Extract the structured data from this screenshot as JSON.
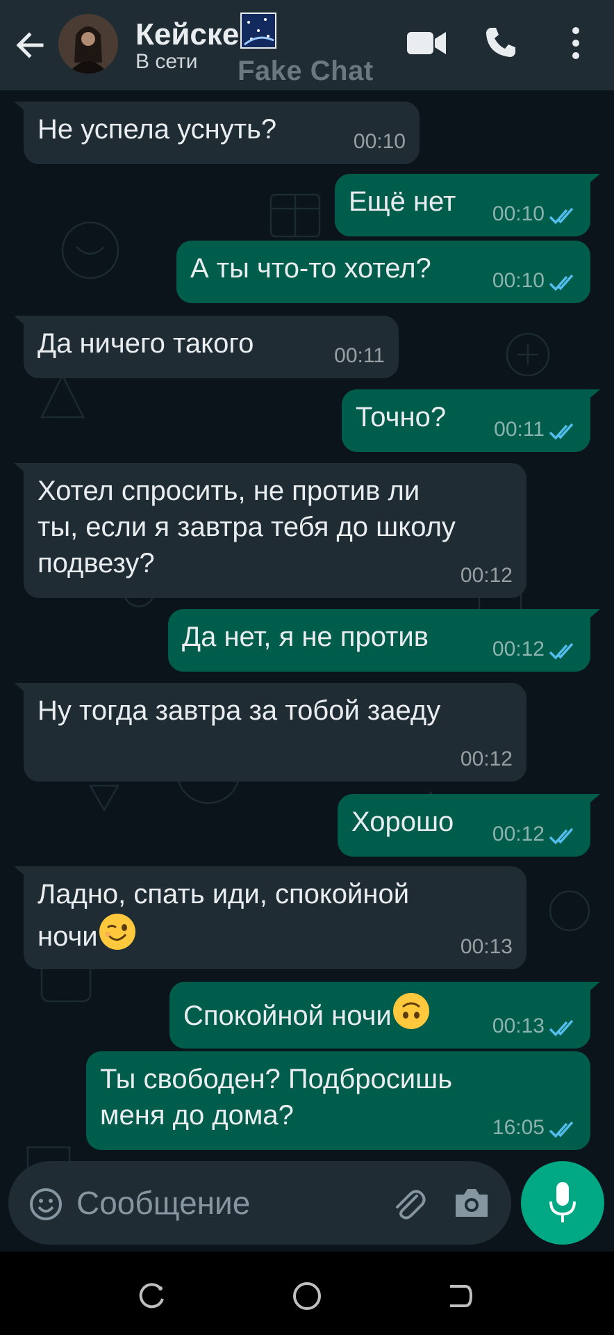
{
  "header": {
    "contact_name": "Кейске",
    "status": "В сети",
    "watermark": "Fake Chat"
  },
  "messages": [
    {
      "dir": "in",
      "text": "Не успела уснуть?",
      "time": "00:10"
    },
    {
      "dir": "out",
      "text": "Ещё нет",
      "time": "00:10",
      "read": true
    },
    {
      "dir": "out",
      "text": "А ты что-то хотел?",
      "time": "00:10",
      "read": true
    },
    {
      "dir": "in",
      "text": "Да ничего такого",
      "time": "00:11"
    },
    {
      "dir": "out",
      "text": "Точно?",
      "time": "00:11",
      "read": true
    },
    {
      "dir": "in",
      "lines": [
        "Хотел спросить, не против ли",
        "ты, если я завтра тебя до школу",
        "подвезу?"
      ],
      "time": "00:12"
    },
    {
      "dir": "out",
      "text": "Да нет, я не против",
      "time": "00:12",
      "read": true
    },
    {
      "dir": "in",
      "text": "Ну тогда завтра за тобой заеду",
      "time": "00:12"
    },
    {
      "dir": "out",
      "text": "Хорошо",
      "time": "00:12",
      "read": true
    },
    {
      "dir": "in",
      "lines": [
        "Ладно, спать иди, спокойной",
        "ночи"
      ],
      "emoji": "winking-face",
      "time": "00:13"
    },
    {
      "dir": "out",
      "text": "Спокойной ночи",
      "emoji": "upside-down-face",
      "time": "00:13",
      "read": true
    },
    {
      "dir": "out",
      "lines": [
        "Ты свободен? Подбросишь",
        "меня до дома?"
      ],
      "time": "16:05",
      "read": true
    }
  ],
  "composer": {
    "placeholder": "Сообщение"
  },
  "icons": {
    "back": "arrow-left-icon",
    "video": "video-call-icon",
    "call": "phone-icon",
    "menu": "more-vert-icon",
    "emoji": "emoji-icon",
    "attach": "paperclip-icon",
    "camera": "camera-icon",
    "mic": "microphone-icon"
  },
  "colors": {
    "header_bg": "#1f2c34",
    "chat_bg": "#0b141a",
    "incoming_bubble": "#1f2c34",
    "outgoing_bubble": "#005c4b",
    "read_ticks": "#53bdeb",
    "accent": "#00a884"
  }
}
